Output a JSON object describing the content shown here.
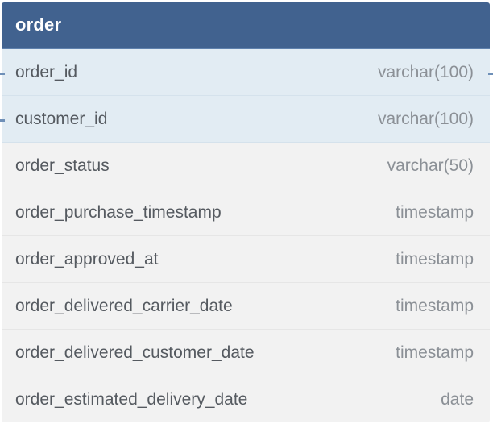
{
  "table": {
    "name": "order",
    "fields": [
      {
        "name": "order_id",
        "type": "varchar(100)",
        "key": true
      },
      {
        "name": "customer_id",
        "type": "varchar(100)",
        "key": true
      },
      {
        "name": "order_status",
        "type": "varchar(50)",
        "key": false
      },
      {
        "name": "order_purchase_timestamp",
        "type": "timestamp",
        "key": false
      },
      {
        "name": "order_approved_at",
        "type": "timestamp",
        "key": false
      },
      {
        "name": "order_delivered_carrier_date",
        "type": "timestamp",
        "key": false
      },
      {
        "name": "order_delivered_customer_date",
        "type": "timestamp",
        "key": false
      },
      {
        "name": "order_estimated_delivery_date",
        "type": "date",
        "key": false
      }
    ]
  },
  "colors": {
    "header": "#41628f",
    "key_row": "#e2ecf3",
    "row": "#f2f2f2",
    "connector": "#6f90b8"
  }
}
